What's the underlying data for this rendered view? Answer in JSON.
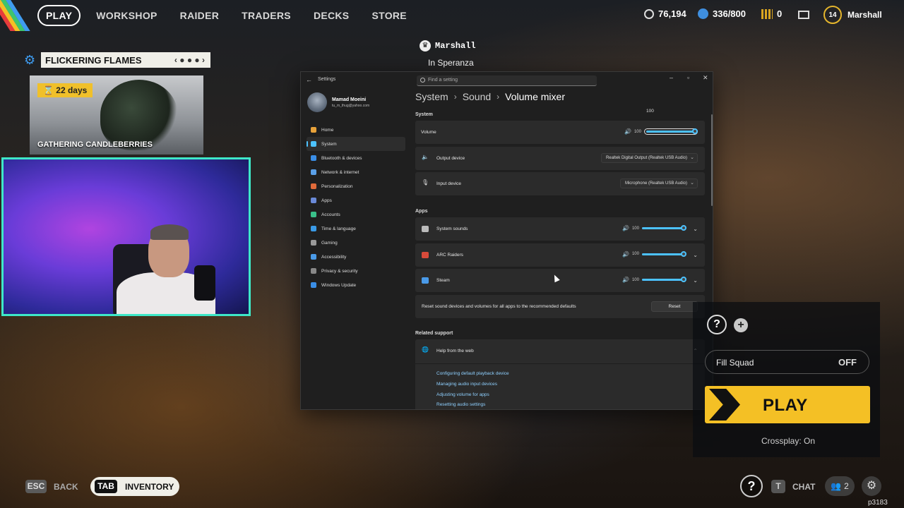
{
  "nav": {
    "items": [
      "PLAY",
      "WORKSHOP",
      "RAIDER",
      "TRADERS",
      "DECKS",
      "STORE"
    ],
    "coins": "76,194",
    "stash": "336/800",
    "tokens": "0",
    "level": "14",
    "username": "Marshall"
  },
  "event": {
    "title": "FLICKERING FLAMES",
    "pager": "‹ ● ● ●  ›",
    "days": "22 days",
    "caption": "GATHERING CANDLEBERRIES"
  },
  "marshall": {
    "name": "Marshall",
    "location": "In Speranza"
  },
  "settings": {
    "window_title": "Settings",
    "search_placeholder": "Find a setting",
    "profile_name": "Mamad Moeini",
    "profile_email": "tu_m_thug@yahoo.com",
    "sidebar": [
      {
        "label": "Home",
        "color": "#e8a23a"
      },
      {
        "label": "System",
        "color": "#4cc2ff"
      },
      {
        "label": "Bluetooth & devices",
        "color": "#3a8ee6"
      },
      {
        "label": "Network & internet",
        "color": "#5aa0e8"
      },
      {
        "label": "Personalization",
        "color": "#e06a3a"
      },
      {
        "label": "Apps",
        "color": "#6a8ad8"
      },
      {
        "label": "Accounts",
        "color": "#3ac08a"
      },
      {
        "label": "Time & language",
        "color": "#3a9ae6"
      },
      {
        "label": "Gaming",
        "color": "#9a9a9a"
      },
      {
        "label": "Accessibility",
        "color": "#4a9ae8"
      },
      {
        "label": "Privacy & security",
        "color": "#888888"
      },
      {
        "label": "Windows Update",
        "color": "#3a8ee6"
      }
    ],
    "breadcrumb": [
      "System",
      "Sound",
      "Volume mixer"
    ],
    "system_section": "System",
    "volume_label": "Volume",
    "volume_value": "100",
    "volume_tooltip": "100",
    "output_label": "Output device",
    "output_value": "Realtek Digital Output (Realtek USB Audio)",
    "input_label": "Input device",
    "input_value": "Microphone (Realtek USB Audio)",
    "apps_section": "Apps",
    "apps": [
      {
        "name": "System sounds",
        "volume": "100",
        "level": 1.0
      },
      {
        "name": "ARC Raiders",
        "volume": "100",
        "level": 1.0
      },
      {
        "name": "Steam",
        "volume": "100",
        "level": 1.0
      }
    ],
    "reset_text": "Reset sound devices and volumes for all apps to the recommended defaults",
    "reset_button": "Reset",
    "related_section": "Related support",
    "help_title": "Help from the web",
    "help_links": [
      "Configuring default playback device",
      "Managing audio input devices",
      "Adjusting volume for apps",
      "Resetting audio settings"
    ]
  },
  "squad": {
    "fill_label": "Fill Squad",
    "fill_value": "OFF",
    "play_label": "PLAY",
    "crossplay": "Crossplay: On"
  },
  "bottom": {
    "esc_key": "ESC",
    "back_label": "BACK",
    "tab_key": "TAB",
    "inventory_label": "INVENTORY",
    "chat_key": "T",
    "chat_label": "CHAT",
    "friends_count": "2",
    "corner_id": "p3183"
  }
}
